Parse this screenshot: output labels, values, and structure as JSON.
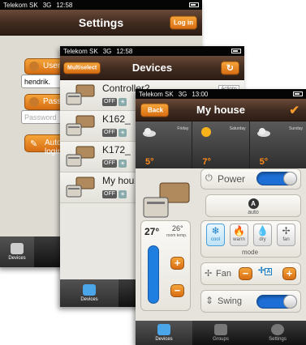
{
  "screen1": {
    "status": {
      "carrier": "Telekom SK",
      "network": "3G",
      "time": "12:58"
    },
    "title": "Settings",
    "login_button": "Log in",
    "user_button": "User",
    "user_value": "hendrik.",
    "password_button": "Password",
    "password_placeholder": "Password",
    "auto_button": "Auto login",
    "tabs": [
      {
        "label": "Devices",
        "icon": "house-icon"
      }
    ]
  },
  "screen2": {
    "status": {
      "carrier": "Telekom SK",
      "network": "3G",
      "time": "12:58"
    },
    "title": "Devices",
    "multiselect_button": "Multiselect",
    "refresh_icon": "refresh-icon",
    "devices": [
      {
        "name": "Controller2",
        "off": "OFF",
        "badge": "Actions"
      },
      {
        "name": "K162_",
        "off": "OFF",
        "badge": ""
      },
      {
        "name": "K172_",
        "off": "OFF",
        "badge": ""
      },
      {
        "name": "My hou",
        "off": "OFF",
        "badge": ""
      }
    ],
    "tabs": [
      {
        "label": "Devices",
        "icon": "house-icon"
      }
    ]
  },
  "screen3": {
    "status": {
      "carrier": "Telekom SK",
      "network": "3G",
      "time": "13:00"
    },
    "title": "My house",
    "back_button": "Back",
    "confirm_icon": "checkmark-icon",
    "weather": [
      {
        "day": "Friday",
        "temp": "5°",
        "icon": "cloud-icon"
      },
      {
        "day": "Saturday",
        "temp": "7°",
        "icon": "sun-icon"
      },
      {
        "day": "Sunday",
        "temp": "5°",
        "icon": "cloud-icon"
      }
    ],
    "power_label": "Power",
    "power_on": true,
    "auto_badge": "A",
    "auto_label": "auto",
    "set_temp": "27°",
    "room_temp": "26°",
    "room_temp_label": "room temp.",
    "modes": [
      {
        "label": "cool",
        "glyph": "❄"
      },
      {
        "label": "warm",
        "glyph": "🔥"
      },
      {
        "label": "dry",
        "glyph": "💧"
      },
      {
        "label": "fan",
        "glyph": "✢"
      }
    ],
    "mode_label": "mode",
    "fan_label": "Fan",
    "fan_mode": "A",
    "swing_label": "Swing",
    "swing_on": true,
    "tabs": [
      {
        "label": "Devices",
        "icon": "house-icon"
      },
      {
        "label": "Groups",
        "icon": "group-icon"
      },
      {
        "label": "Settings",
        "icon": "gear-icon"
      }
    ]
  },
  "colors": {
    "accent": "#f39a2e",
    "toggle_on": "#1d6fd6",
    "temp_orange": "#ff8a1a"
  }
}
